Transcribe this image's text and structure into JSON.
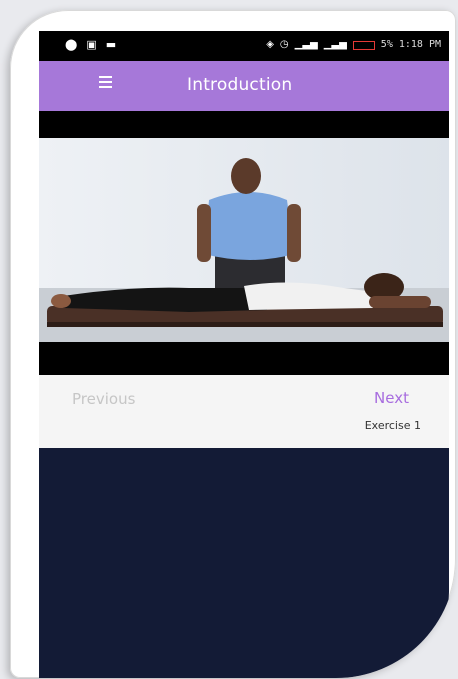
{
  "statusbar": {
    "left_icons": [
      "notification-icon",
      "image-icon",
      "message-icon"
    ],
    "right_icons": [
      "wifi-icon",
      "alarm-icon",
      "signal-icon",
      "signal-icon"
    ],
    "battery_percent": "5%",
    "time": "1:18 PM"
  },
  "appbar": {
    "title": "Introduction",
    "menu_icon": "hamburger-menu-icon"
  },
  "video": {
    "description_icon": "video-thumbnail"
  },
  "navigation": {
    "previous_label": "Previous",
    "next_label": "Next",
    "next_subtitle": "Exercise 1"
  },
  "colors": {
    "appbar": "#a678d9",
    "accent": "#a86ddf",
    "content_bg": "#131b36",
    "battery_low": "#e53935"
  }
}
